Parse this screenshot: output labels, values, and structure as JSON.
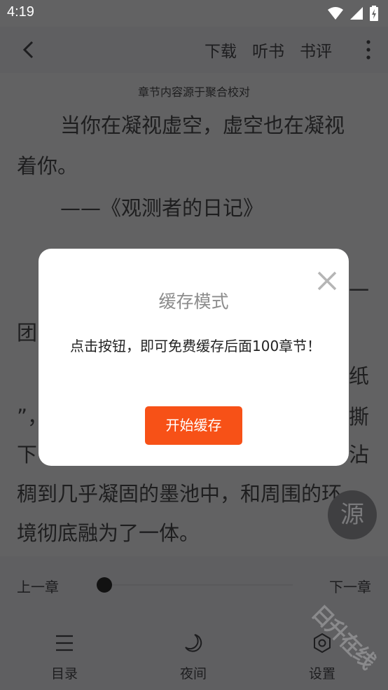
{
  "status_bar": {
    "time": "4:19",
    "icons": [
      "wifi-icon",
      "cell-signal-icon",
      "battery-charging-icon"
    ]
  },
  "toolbar": {
    "back_icon": "back-arrow-icon",
    "download": "下载",
    "listen": "听书",
    "review": "书评",
    "more_icon": "more-vert-icon"
  },
  "reader": {
    "source_note": "章节内容源于聚合校对",
    "lines": [
      "当你在凝视虚空，虚空也在凝视",
      "着你。",
      "——《观测者的日记》",
      "一",
      "团",
      "纸",
      "”，",
      "撕",
      "下",
      "沾",
      "稠到几乎凝固的墨池中，和周围的环",
      "境彻底融为了一体。"
    ]
  },
  "source_button": "源",
  "progress": {
    "prev": "上一章",
    "next": "下一章",
    "position": 0.04
  },
  "bottom_nav": [
    {
      "icon": "menu-list-icon",
      "label": "目录"
    },
    {
      "icon": "moon-icon",
      "label": "夜间"
    },
    {
      "icon": "settings-gear-icon",
      "label": "设置"
    }
  ],
  "watermark": "日升在线",
  "dialog": {
    "title": "缓存模式",
    "message": "点击按钮，即可免费缓存后面100章节！",
    "button": "开始缓存",
    "close_icon": "close-icon"
  },
  "colors": {
    "overlay_bg": "#626263",
    "accent": "#f75117",
    "dialog_bg": "#ffffff"
  }
}
